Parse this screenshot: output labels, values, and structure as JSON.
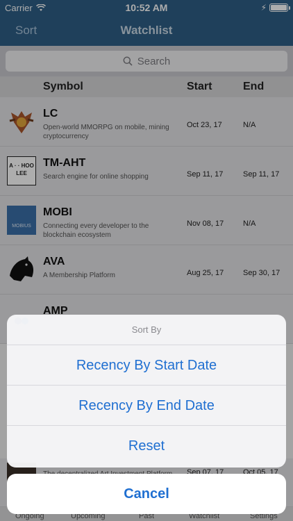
{
  "status": {
    "carrier": "Carrier",
    "time": "10:52 AM"
  },
  "nav": {
    "left": "Sort",
    "title": "Watchlist"
  },
  "search": {
    "placeholder": "Search"
  },
  "columns": {
    "symbol": "Symbol",
    "start": "Start",
    "end": "End"
  },
  "rows": [
    {
      "symbol": "LC",
      "desc": "Open-world MMORPG on mobile, mining cryptocurrency",
      "start": "Oct 23, 17",
      "end": "N/A",
      "logo": "lc-crest-icon"
    },
    {
      "symbol": "TM-AHT",
      "desc": "Search engine for online shopping",
      "start": "Sep 11, 17",
      "end": "Sep 11, 17",
      "logo": "ahoolee-icon",
      "logo_text": "A · · HOO LEE"
    },
    {
      "symbol": "MOBI",
      "desc": "Connecting every developer to the blockchain ecosystem",
      "start": "Nov 08, 17",
      "end": "N/A",
      "logo": "mobius-icon",
      "logo_text": "MOBIUS"
    },
    {
      "symbol": "AVA",
      "desc": "A Membership Platform",
      "start": "Aug 25, 17",
      "end": "Sep 30, 17",
      "logo": "knight-icon"
    },
    {
      "symbol": "AMP",
      "desc": "",
      "start": "",
      "end": "",
      "logo": "amp-icon"
    }
  ],
  "hidden_row": {
    "desc": "The decentralized Art Investment Platform",
    "start": "Sep 07, 17",
    "end": "Oct 05, 17"
  },
  "tabs": [
    "Ongoing",
    "Upcoming",
    "Past",
    "Watchlist",
    "Settings"
  ],
  "sheet": {
    "title": "Sort By",
    "actions": [
      "Recency By Start Date",
      "Recency By End Date",
      "Reset"
    ],
    "cancel": "Cancel"
  },
  "colors": {
    "nav": "#2f5f86",
    "action": "#1f6fd1"
  }
}
